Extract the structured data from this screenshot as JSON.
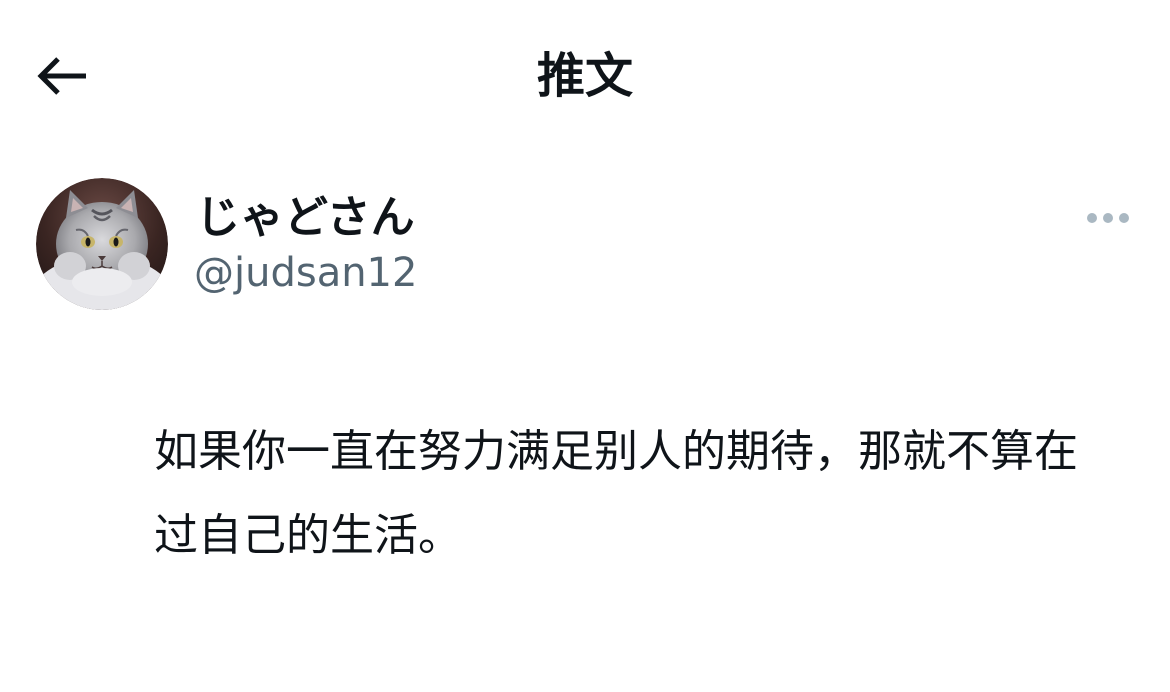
{
  "header": {
    "title": "推文",
    "back_icon": "arrow-left-icon"
  },
  "author": {
    "display_name": "じゃどさん",
    "handle": "@judsan12",
    "avatar_description_icon": "cat-avatar"
  },
  "actions": {
    "more_icon": "more-horizontal-icon"
  },
  "tweet": {
    "text": "如果你一直在努力满足别人的期待，那就不算在过自己的生活。"
  },
  "colors": {
    "text_primary": "#0f1419",
    "text_secondary": "#536471",
    "more_icon": "#aab8c2",
    "background": "#ffffff"
  }
}
